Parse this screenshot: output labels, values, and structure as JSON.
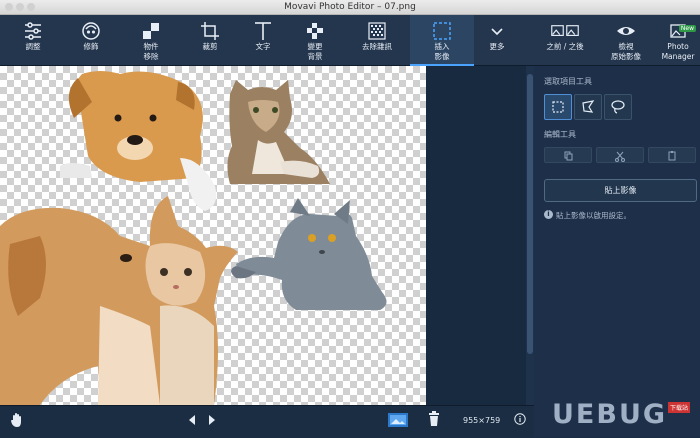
{
  "window": {
    "title": "Movavi Photo Editor – 07.png"
  },
  "toolbar": {
    "items": [
      {
        "label": "調整",
        "icon": "sliders-icon"
      },
      {
        "label": "修飾",
        "icon": "face-icon"
      },
      {
        "label": "物件\n移除",
        "icon": "eraser-icon"
      },
      {
        "label": "裁剪",
        "icon": "crop-icon"
      },
      {
        "label": "文字",
        "icon": "text-icon"
      },
      {
        "label": "變更\n背景",
        "icon": "background-icon"
      },
      {
        "label": "去除雜訊",
        "icon": "noise-icon"
      },
      {
        "label": "插入\n影像",
        "icon": "insert-image-icon",
        "active": true
      },
      {
        "label": "更多",
        "icon": "chevron-down-icon"
      },
      {
        "label": "之前 / 之後",
        "icon": "before-after-icon"
      },
      {
        "label": "檢視\n原始影像",
        "icon": "eye-icon"
      },
      {
        "label": "Photo\nManager",
        "icon": "photo-manager-icon",
        "badge": "New"
      }
    ]
  },
  "panel": {
    "select_tools_label": "選取項目工具",
    "edit_tools_label": "編輯工具",
    "paste_button": "貼上影像",
    "hint": "貼上影像以啟用設定。"
  },
  "bottom": {
    "dimensions": "955×759"
  },
  "watermark": {
    "text": "UEBUG",
    "tag": "下载站"
  },
  "colors": {
    "accent": "#4aa3ff",
    "toolbar": "#24364e",
    "panel": "#1e3049"
  }
}
